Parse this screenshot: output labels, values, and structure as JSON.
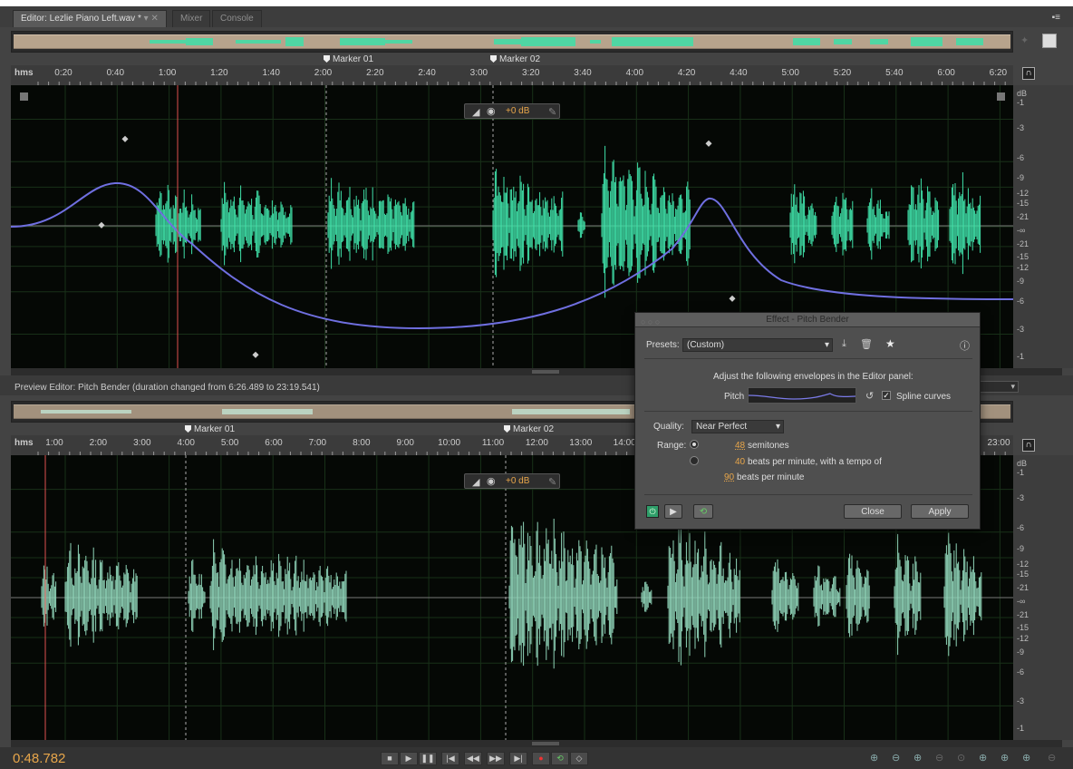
{
  "tabs": [
    {
      "label": "Editor: Lezlie Piano Left.wav *"
    },
    {
      "label": "Mixer"
    },
    {
      "label": "Console"
    }
  ],
  "top_editor": {
    "time_format": "hms",
    "ticks": [
      "0:20",
      "0:40",
      "1:00",
      "1:20",
      "1:40",
      "2:00",
      "2:20",
      "2:40",
      "3:00",
      "3:20",
      "3:40",
      "4:00",
      "4:20",
      "4:40",
      "5:00",
      "5:20",
      "5:40",
      "6:00",
      "6:20"
    ],
    "markers": [
      "Marker 01",
      "Marker 02"
    ],
    "hud_gain": "+0 dB",
    "db_scale": [
      "dB",
      "-1",
      "-3",
      "-6",
      "-9",
      "-12",
      "-15",
      "-21",
      "-∞",
      "-21",
      "-15",
      "-12",
      "-9",
      "-6",
      "-3",
      "-1"
    ]
  },
  "preview": {
    "title": "Preview Editor: Pitch Bender (duration changed from 6:26.489 to 23:19.541)",
    "time_format": "hms",
    "ticks": [
      "1:00",
      "2:00",
      "3:00",
      "4:00",
      "5:00",
      "6:00",
      "7:00",
      "8:00",
      "9:00",
      "10:00",
      "11:00",
      "12:00",
      "13:00",
      "14:00",
      "23:00"
    ],
    "markers": [
      "Marker 01",
      "Marker 02"
    ],
    "hud_gain": "+0 dB",
    "db_scale": [
      "dB",
      "-1",
      "-3",
      "-6",
      "-9",
      "-12",
      "-15",
      "-21",
      "-∞",
      "-21",
      "-15",
      "-12",
      "-9",
      "-6",
      "-3",
      "-1"
    ]
  },
  "dialog": {
    "title": "Effect - Pitch Bender",
    "presets_label": "Presets:",
    "preset_value": "(Custom)",
    "instructions": "Adjust the following envelopes in the Editor panel:",
    "pitch_label": "Pitch",
    "spline_label": "Spline curves",
    "quality_label": "Quality:",
    "quality_value": "Near Perfect",
    "range_label": "Range:",
    "semitones_value": "48",
    "semitones_label": "semitones",
    "bpm_value": "40",
    "bpm_label": "beats per minute, with a tempo of",
    "tempo_value": "90",
    "tempo_label": "beats per minute",
    "close_label": "Close",
    "apply_label": "Apply"
  },
  "transport": {
    "time": "0:48.782"
  },
  "colors": {
    "waveform": "#3fe0a8",
    "preview_waveform": "#8fd4b8",
    "envelope": "#6f6fe0",
    "playhead": "#e05050",
    "time": "#e8a64a"
  }
}
